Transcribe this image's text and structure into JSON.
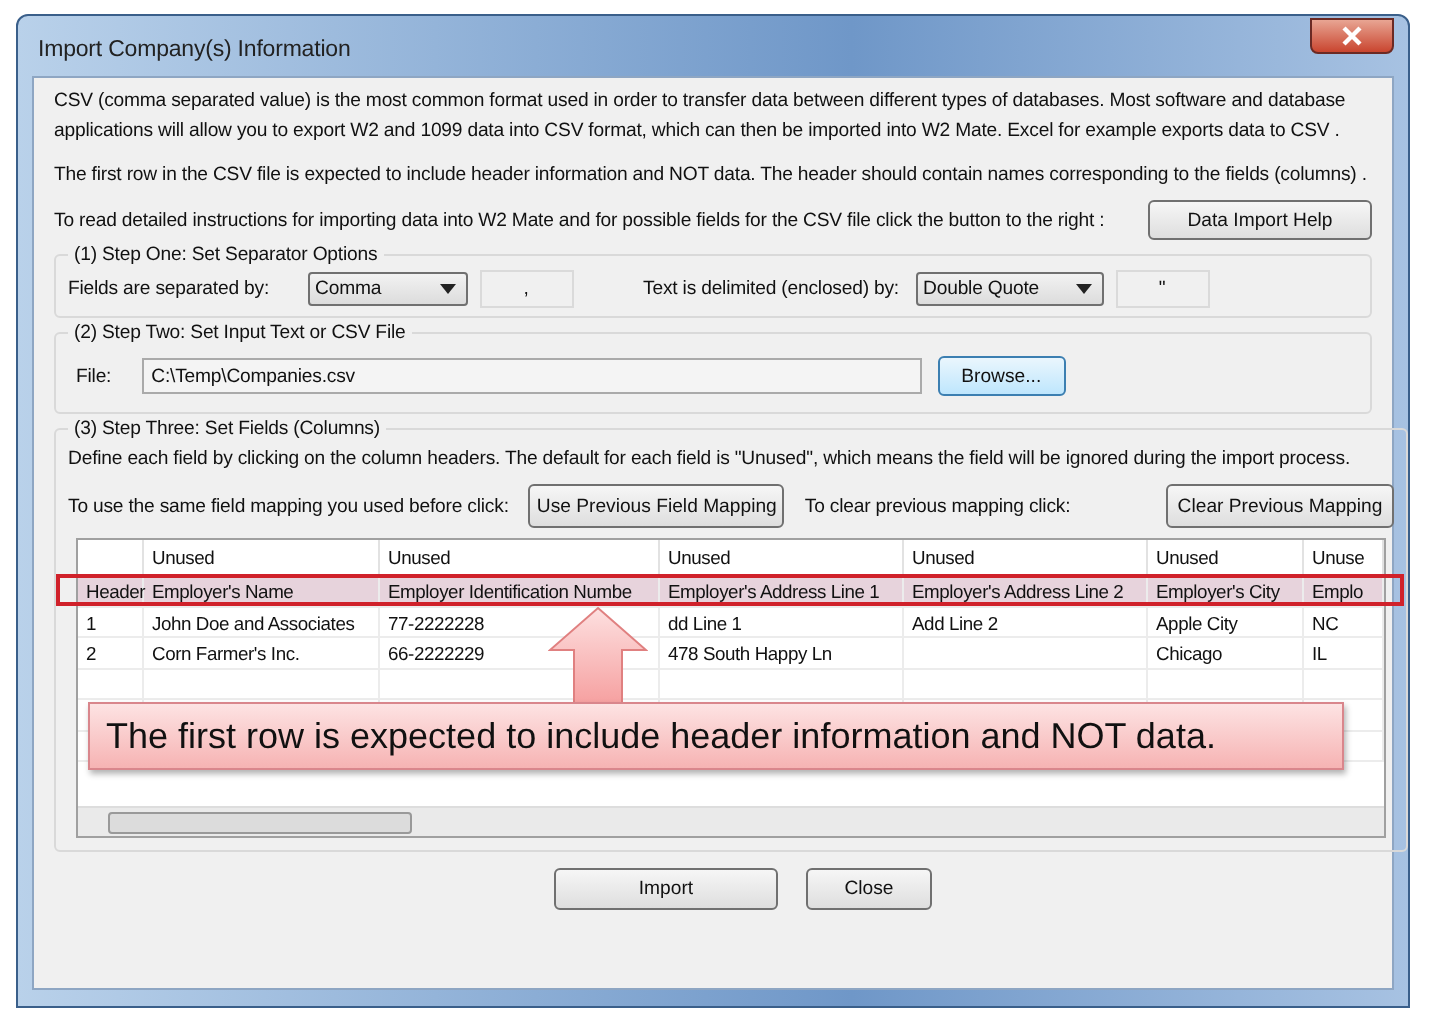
{
  "window": {
    "title": "Import Company(s) Information"
  },
  "intro": [
    "CSV (comma separated value) is the most common format used in order to transfer data between different types of databases.  Most software and database applications will allow you to export W2 and 1099 data into CSV format, which can then be imported into W2 Mate. Excel for example exports data to CSV .",
    "The first row in the CSV file is expected to include header information and NOT data. The header should contain names corresponding to the fields (columns) ."
  ],
  "help": {
    "text": "To read detailed instructions for importing data into W2 Mate and for possible fields for the CSV file click the button to the right :",
    "button": "Data Import Help"
  },
  "step1": {
    "title": "(1)  Step One: Set Separator Options",
    "fields_label": "Fields are separated by:",
    "fields_value": "Comma",
    "fields_char": ",",
    "text_label": "Text is delimited (enclosed) by:",
    "text_value": "Double Quote",
    "text_char": "\""
  },
  "step2": {
    "title": "(2)  Step Two: Set Input Text or CSV File",
    "file_label": "File:",
    "file_value": "C:\\Temp\\Companies.csv",
    "browse": "Browse..."
  },
  "step3": {
    "title": "(3)  Step Three: Set Fields (Columns)",
    "description": "Define each field by clicking on the column headers. The default for each field is \"Unused\", which means the field will be ignored during the import process.",
    "use_label": "To use the same field mapping you used before click:",
    "use_button": "Use Previous Field Mapping",
    "clear_label": "To clear previous mapping click:",
    "clear_button": "Clear Previous Mapping"
  },
  "table": {
    "columns": [
      "",
      "Unused",
      "Unused",
      "Unused",
      "Unused",
      "Unused",
      "Unuse"
    ],
    "rows": [
      {
        "highlighted": true,
        "cells": [
          "Header",
          "Employer's Name",
          "Employer Identification Numbe",
          "Employer's Address Line 1",
          "Employer's Address Line 2",
          "Employer's City",
          "Emplo"
        ]
      },
      {
        "highlighted": false,
        "cells": [
          "1",
          "John Doe and Associates",
          "77-2222228",
          "dd  Line 1",
          "Add  Line 2",
          "Apple City",
          "NC"
        ]
      },
      {
        "highlighted": false,
        "cells": [
          "2",
          "Corn Farmer's Inc.",
          "66-2222229",
          "478 South Happy Ln",
          "",
          "Chicago",
          "IL"
        ]
      }
    ]
  },
  "callout": "The first row is expected to include header information and NOT data.",
  "buttons": [
    "Import",
    "Close"
  ]
}
